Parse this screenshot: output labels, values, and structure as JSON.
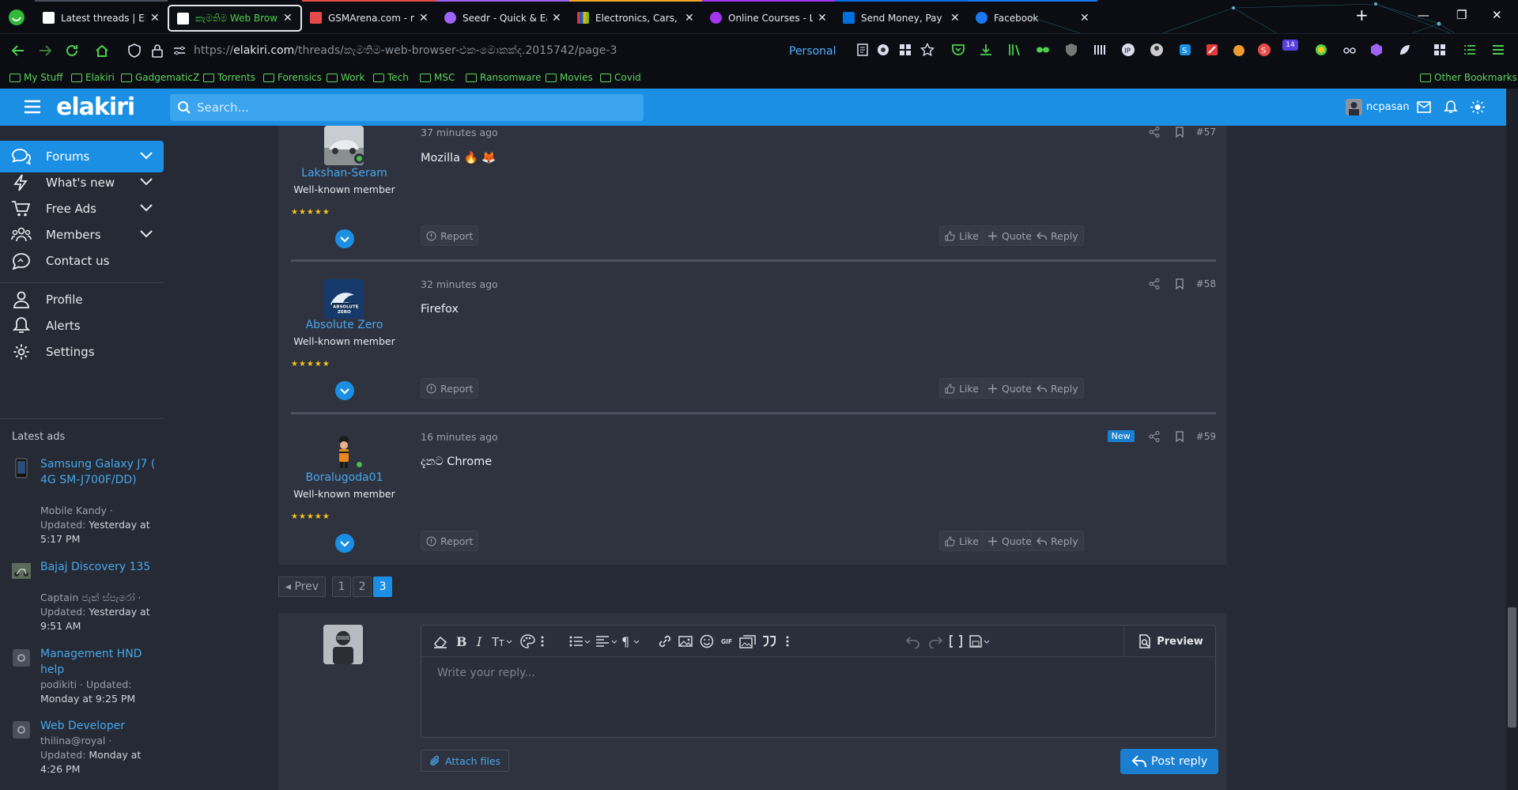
{
  "browser": {
    "tabs": [
      {
        "title": "Latest threads | ElaKiri",
        "accent": "#ffffff"
      },
      {
        "title": "කැමතිම Web Browser එක මොකක්ද",
        "accent": "#4dd04d"
      },
      {
        "title": "GSMArena.com - mobile phone reviews",
        "accent": "#e84a4a"
      },
      {
        "title": "Seedr - Quick & Easy",
        "accent": "#a162f7"
      },
      {
        "title": "Electronics, Cars, Fashion, Collectibles",
        "accent": "#f5a623"
      },
      {
        "title": "Online Courses - Learn Anything",
        "accent": "#a435f0"
      },
      {
        "title": "Send Money, Pay Online or Set Up",
        "accent": "#0070e0"
      },
      {
        "title": "Facebook",
        "accent": "#1877f2"
      }
    ],
    "new_tab": "+",
    "url_prefix": "https://",
    "url_host": "elakiri.com",
    "url_path": "/threads/කැමතිම-web-browser-එක-මොකක්ද.2015742/page-3",
    "container_label": "Personal",
    "extension_badge": "14",
    "bookmarks": [
      "My Stuff",
      "Elakiri",
      "GadgematicZ",
      "Torrents",
      "Forensics",
      "Work",
      "Tech",
      "MSC",
      "Ransomware",
      "Movies",
      "Covid"
    ],
    "other_bookmarks": "Other Bookmarks"
  },
  "site": {
    "logo": "elakiri",
    "search_placeholder": "Search...",
    "username": "ncpasan"
  },
  "sidebar": {
    "nav": [
      {
        "label": "Forums",
        "icon": "comments-icon",
        "chevron": true
      },
      {
        "label": "What's new",
        "icon": "bolt-icon",
        "chevron": true
      },
      {
        "label": "Free Ads",
        "icon": "cart-icon",
        "chevron": true
      },
      {
        "label": "Members",
        "icon": "users-icon",
        "chevron": true
      },
      {
        "label": "Contact us",
        "icon": "chat-icon",
        "chevron": false
      }
    ],
    "account": [
      {
        "label": "Profile",
        "icon": "user-icon"
      },
      {
        "label": "Alerts",
        "icon": "bell-icon"
      },
      {
        "label": "Settings",
        "icon": "gear-icon"
      }
    ],
    "latest_ads_heading": "Latest ads",
    "ads": [
      {
        "title": "Samsung Galaxy J7 ( 4G SM-J700F/DD)",
        "author": "Mobile Kandy",
        "updated_label": "Updated:",
        "updated": "Yesterday at 5:17 PM"
      },
      {
        "title": "Bajaj Discovery 135",
        "author": "Captain ජැක් ස්පැරෝ",
        "updated_label": "Updated:",
        "updated": "Yesterday at 9:51 AM"
      },
      {
        "title": "Management HND help",
        "author": "podikiti",
        "updated_label": "Updated:",
        "updated": "Monday at 9:25 PM"
      },
      {
        "title": "Web Developer",
        "author": "thilina@royal",
        "updated_label": "Updated:",
        "updated": "Monday at 4:26 PM"
      }
    ]
  },
  "posts": [
    {
      "username": "Lakshan-Seram",
      "role": "Well-known member",
      "stars": "★★★★★",
      "time": "37 minutes ago",
      "content": "Mozilla 🔥 🦊",
      "number": "#57",
      "is_new": false
    },
    {
      "username": "Absolute Zero",
      "role": "Well-known member",
      "stars": "★★★★★",
      "time": "32 minutes ago",
      "content": "Firefox",
      "number": "#58",
      "is_new": false
    },
    {
      "username": "Boralugoda01",
      "role": "Well-known member",
      "stars": "★★★★★",
      "time": "16 minutes ago",
      "content": "දැනට Chrome",
      "number": "#59",
      "is_new": true
    }
  ],
  "post_actions": {
    "report": "Report",
    "like": "Like",
    "quote": "Quote",
    "reply": "Reply",
    "new_badge": "New"
  },
  "pagination": {
    "prev": "◂ Prev",
    "pages": [
      "1",
      "2",
      "3"
    ],
    "current": "3"
  },
  "reply_form": {
    "placeholder": "Write your reply...",
    "preview": "Preview",
    "attach": "Attach files",
    "submit": "Post reply"
  },
  "colors": {
    "accent": "#1a8fe3",
    "background": "#262a35",
    "panel": "#2f3340",
    "link": "#47a7eb",
    "star": "#f5c518"
  }
}
